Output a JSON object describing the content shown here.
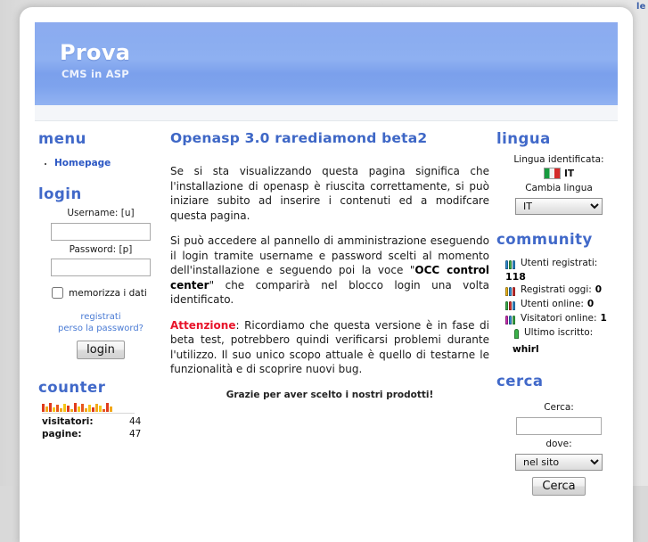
{
  "stray_text": "le",
  "banner": {
    "title": "Prova",
    "subtitle": "CMS in ASP",
    "gradient_color": "#8cabef"
  },
  "sidebar_left": {
    "menu": {
      "title": "menu",
      "items": [
        {
          "label": "Homepage"
        }
      ]
    },
    "login": {
      "title": "login",
      "username_label": "Username: [u]",
      "username_value": "",
      "username_placeholder": "",
      "password_label": "Password: [p]",
      "password_value": "",
      "password_placeholder": "",
      "remember_label": "memorizza i dati",
      "remember_checked": false,
      "register_link": "registrati",
      "lost_password_link": "perso la password?",
      "submit_label": "login"
    },
    "counter": {
      "title": "counter",
      "rows": [
        {
          "key": "visitatori:",
          "value": "44"
        },
        {
          "key": "pagine:",
          "value": "47"
        }
      ],
      "graph_bars": [
        {
          "h": 9,
          "c": "#e03c1c"
        },
        {
          "h": 6,
          "c": "#f2a81a"
        },
        {
          "h": 10,
          "c": "#e03c1c"
        },
        {
          "h": 5,
          "c": "#f5c518"
        },
        {
          "h": 8,
          "c": "#e8571d"
        },
        {
          "h": 4,
          "c": "#f2a81a"
        },
        {
          "h": 9,
          "c": "#f5c518"
        },
        {
          "h": 7,
          "c": "#e03c1c"
        },
        {
          "h": 3,
          "c": "#f2a81a"
        },
        {
          "h": 10,
          "c": "#e03c1c"
        },
        {
          "h": 6,
          "c": "#f5c518"
        },
        {
          "h": 9,
          "c": "#e8571d"
        },
        {
          "h": 4,
          "c": "#f2a81a"
        },
        {
          "h": 8,
          "c": "#f5c518"
        },
        {
          "h": 5,
          "c": "#e03c1c"
        },
        {
          "h": 9,
          "c": "#f2a81a"
        },
        {
          "h": 7,
          "c": "#f5c518"
        },
        {
          "h": 3,
          "c": "#e8571d"
        },
        {
          "h": 10,
          "c": "#e03c1c"
        },
        {
          "h": 6,
          "c": "#f2a81a"
        }
      ]
    }
  },
  "main": {
    "title": "Openasp 3.0 rarediamond beta2",
    "paragraph1": "Se si sta visualizzando questa pagina significa che l'installazione di openasp è riuscita correttamente, si può iniziare subito ad inserire i contenuti ed a modifcare questa pagina.",
    "paragraph2_before": "Si può accedere al pannello di amministrazione eseguendo il login tramite username e password scelti al momento dell'installazione e seguendo poi la voce \"",
    "paragraph2_bold": "OCC control center",
    "paragraph2_after": "\" che comparirà nel blocco login una volta identificato.",
    "warning_label": "Attenzione",
    "paragraph3": ": Ricordiamo che questa versione è in fase di beta test, potrebbero quindi verificarsi problemi durante l'utilizzo. Il suo unico scopo attuale è quello di testarne le funzionalità e di scoprire nuovi bug.",
    "thanks": "Grazie per aver scelto i nostri prodotti!"
  },
  "sidebar_right": {
    "lingua": {
      "title": "lingua",
      "detected_label": "Lingua identificata:",
      "detected_code": "IT",
      "change_label": "Cambia lingua",
      "select_value": "IT",
      "select_options": [
        "IT"
      ]
    },
    "community": {
      "title": "community",
      "registered_label": "Utenti registrati:",
      "registered_count": "118",
      "items": [
        {
          "label": "Registrati oggi:",
          "value": "0",
          "colors": [
            "#f2b91c",
            "#2f8fd6",
            "#d83030"
          ]
        },
        {
          "label": "Utenti online:",
          "value": "0",
          "colors": [
            "#3bb24a",
            "#d83030",
            "#2f8fd6"
          ]
        },
        {
          "label": "Visitatori online:",
          "value": "1",
          "colors": [
            "#d02fb8",
            "#2f8fd6",
            "#3bb24a"
          ]
        }
      ],
      "registered_colors": [
        "#2f8fd6",
        "#3bb24a",
        "#2f8fd6"
      ],
      "last_label": "Ultimo iscritto:",
      "last_value": "whirl",
      "last_color": "#3bb24a"
    },
    "cerca": {
      "title": "cerca",
      "search_label": "Cerca:",
      "search_value": "",
      "search_placeholder": "",
      "where_label": "dove:",
      "where_value": "nel sito",
      "where_options": [
        "nel sito"
      ],
      "submit_label": "Cerca"
    }
  }
}
